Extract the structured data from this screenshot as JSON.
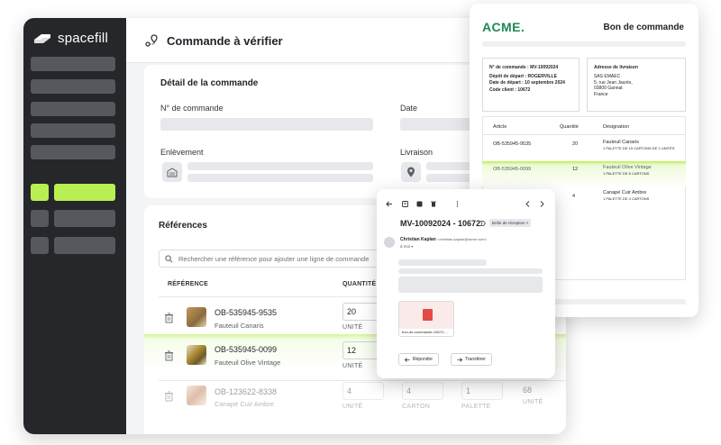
{
  "sidebar": {
    "brand": "spacefill"
  },
  "header": {
    "title": "Commande à vérifier"
  },
  "detail": {
    "title": "Détail de la commande",
    "order_number_label": "N° de commande",
    "date_label": "Date",
    "pickup_label": "Enlèvement",
    "delivery_label": "Livraison"
  },
  "references": {
    "title": "Références",
    "search_placeholder": "Rechercher une référence pour ajouter une ligne de commande",
    "col_reference": "RÉFÉRENCE",
    "col_quantity": "QUANTITÉ",
    "rows": [
      {
        "code": "OB-535945-9535",
        "name": "Fauteuil Canaris",
        "qty": "20",
        "unit": "UNITÉ"
      },
      {
        "code": "OB-535945-0099",
        "name": "Fauteuil Olive Vintage",
        "qty": "12",
        "unit": "UNITÉ"
      },
      {
        "code": "OB-123622-8338",
        "name": "Canapé Cuir Ambre",
        "qty": "4",
        "unit": "UNITÉ",
        "qty2": "4",
        "unit2": "CARTON",
        "qty3": "1",
        "unit3": "PALETTE",
        "total": "68",
        "total_unit": "UNITÉ"
      }
    ]
  },
  "document": {
    "brand": "ACME.",
    "title": "Bon de commande",
    "order_no": "N° de commande : MV-10092024",
    "depot": "Dépôt de départ : ROGERVILLE",
    "departure_date": "Date de départ : 10 septembre 2024",
    "client_code": "Code client : 10672",
    "address_label": "Adresse de livraison",
    "address_lines": [
      "SAS EMAEC",
      "5, rue Jean Jaurès,",
      "03800 Gannat",
      "France"
    ],
    "col_article": "Article",
    "col_quantity": "Quantité",
    "col_designation": "Désignation",
    "rows": [
      {
        "article": "OB-535945-9535",
        "qty": "20",
        "designation": "Fauteuil Canaris",
        "detail": "1 PALETTE DE 10 CARTONS DE 2 UNITÉS"
      },
      {
        "article": "OB-535945-0099",
        "qty": "12",
        "designation": "Fauteuil Olive Vintage",
        "detail": "1 PALETTE DE 6 CARTONS"
      },
      {
        "article": "",
        "qty": "4",
        "designation": "Canapé Cuir Ambre",
        "detail": "1 PALETTE DE 4 CARTONS"
      }
    ]
  },
  "email": {
    "subject": "MV-10092024 - 10672",
    "inbox_badge": "Boîte de réception ×",
    "sender_name": "Christian Kaplan",
    "sender_email": "<christian.kaplan@acme.com>",
    "recipient": "à moi",
    "attachment_name": "bon-de-commande-10672-...",
    "reply_label": "Répondre",
    "forward_label": "Transférer"
  },
  "colors": {
    "accent": "#b9ef52",
    "sidebar": "#25272a",
    "brand_green": "#1d8a54",
    "pdf_red": "#e24b45"
  }
}
